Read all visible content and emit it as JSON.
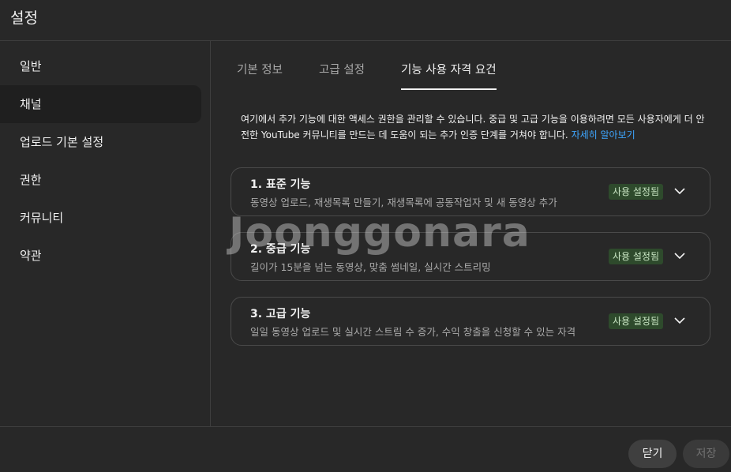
{
  "header": {
    "title": "설정"
  },
  "sidebar": {
    "items": [
      {
        "label": "일반"
      },
      {
        "label": "채널"
      },
      {
        "label": "업로드 기본 설정"
      },
      {
        "label": "권한"
      },
      {
        "label": "커뮤니티"
      },
      {
        "label": "약관"
      }
    ],
    "active_index": 1
  },
  "tabs": [
    {
      "label": "기본 정보"
    },
    {
      "label": "고급 설정"
    },
    {
      "label": "기능 사용 자격 요건"
    }
  ],
  "active_tab": 2,
  "intro": {
    "text": "여기에서 추가 기능에 대한 액세스 권한을 관리할 수 있습니다. 중급 및 고급 기능을 이용하려면 모든 사용자에게 더 안전한 YouTube 커뮤니티를 만드는 데 도움이 되는 추가 인증 단계를 거쳐야 합니다.",
    "link": "자세히 알아보기"
  },
  "features": [
    {
      "title": "1. 표준 기능",
      "description": "동영상 업로드, 재생목록 만들기, 재생목록에 공동작업자 및 새 동영상 추가",
      "status": "사용 설정됨",
      "chevron_icon": "chevron-down-icon"
    },
    {
      "title": "2. 중급 기능",
      "description": "길이가 15분을 넘는 동영상, 맞춤 썸네일, 실시간 스트리밍",
      "status": "사용 설정됨",
      "chevron_icon": "chevron-down-icon"
    },
    {
      "title": "3. 고급 기능",
      "description": "일일 동영상 업로드 및 실시간 스트림 수 증가, 수익 창출을 신청할 수 있는 자격",
      "status": "사용 설정됨",
      "chevron_icon": "chevron-down-icon"
    }
  ],
  "watermark": "Joonggonara",
  "footer": {
    "close_label": "닫기",
    "save_label": "저장"
  },
  "colors": {
    "background": "#282828",
    "active_nav": "#1f1f1f",
    "link": "#3ea6ff",
    "badge_bg": "#2e4a2c",
    "badge_text": "#c9e6c4"
  }
}
